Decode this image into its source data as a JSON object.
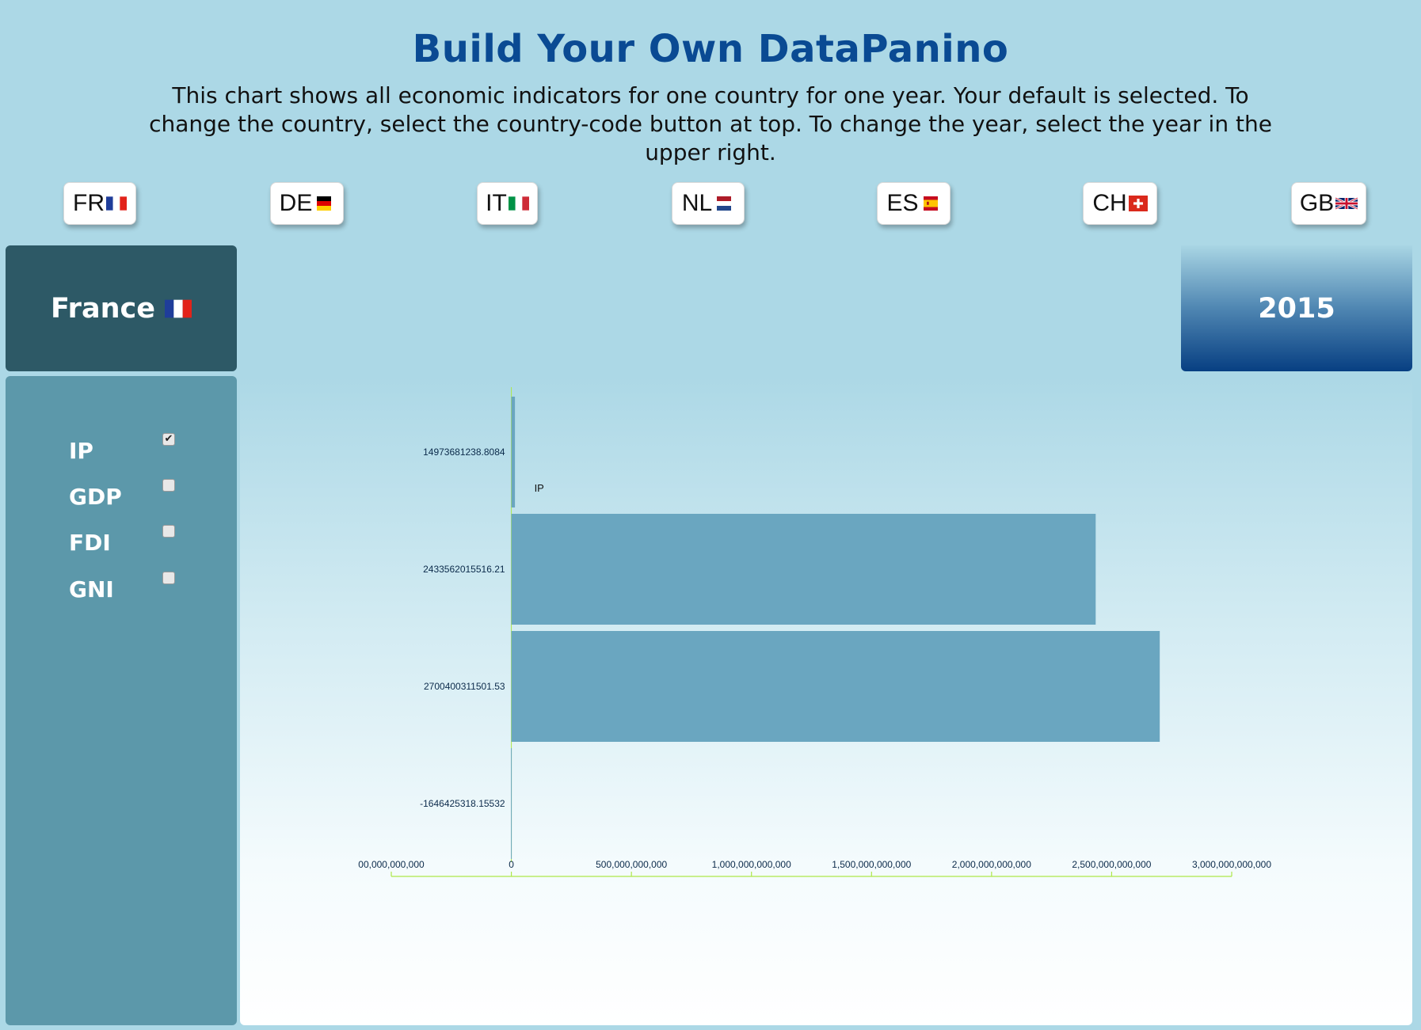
{
  "page": {
    "title": "Build Your Own DataPanino",
    "intro": "This chart shows all economic indicators for one country for one year. Your default is selected. To change the country, select the country-code button at top. To change the year, select the year in the upper right."
  },
  "country_buttons": [
    {
      "code": "FR",
      "flag": "france-flag-icon"
    },
    {
      "code": "DE",
      "flag": "germany-flag-icon"
    },
    {
      "code": "IT",
      "flag": "italy-flag-icon"
    },
    {
      "code": "NL",
      "flag": "netherlands-flag-icon"
    },
    {
      "code": "ES",
      "flag": "spain-flag-icon"
    },
    {
      "code": "CH",
      "flag": "switzerland-flag-icon"
    },
    {
      "code": "GB",
      "flag": "uk-flag-icon"
    }
  ],
  "selected_country": {
    "name": "France",
    "flag": "france-flag-icon"
  },
  "selected_year": "2015",
  "indicators": [
    {
      "label": "IP",
      "checked": true
    },
    {
      "label": "GDP",
      "checked": false
    },
    {
      "label": "FDI",
      "checked": false
    },
    {
      "label": "GNI",
      "checked": false
    }
  ],
  "colors": {
    "background": "#acd8e6",
    "title": "#0a4a93",
    "country_panel": "#2d5966",
    "sidebar": "#5c98aa",
    "bar": "#6aa6c0",
    "axis": "#aee84a",
    "year_gradient_bottom": "#073f82"
  },
  "chart_data": {
    "type": "bar",
    "orientation": "horizontal",
    "categories": [
      "14973681238.8084",
      "2433562015516.21",
      "2700400311501.53",
      "-1646425318.15532"
    ],
    "values": [
      14973681238.8084,
      2433562015516.21,
      2700400311501.53,
      -1646425318.15532
    ],
    "annotation": "IP",
    "x_ticks": [
      {
        "value": -500000000000,
        "label": "00,000,000,000"
      },
      {
        "value": 0,
        "label": "0"
      },
      {
        "value": 500000000000,
        "label": "500,000,000,000"
      },
      {
        "value": 1000000000000,
        "label": "1,000,000,000,000"
      },
      {
        "value": 1500000000000,
        "label": "1,500,000,000,000"
      },
      {
        "value": 2000000000000,
        "label": "2,000,000,000,000"
      },
      {
        "value": 2500000000000,
        "label": "2,500,000,000,000"
      },
      {
        "value": 3000000000000,
        "label": "3,000,000,000,000"
      }
    ],
    "xlim": [
      -500000000000,
      3000000000000
    ],
    "grid": false,
    "legend": "none"
  }
}
